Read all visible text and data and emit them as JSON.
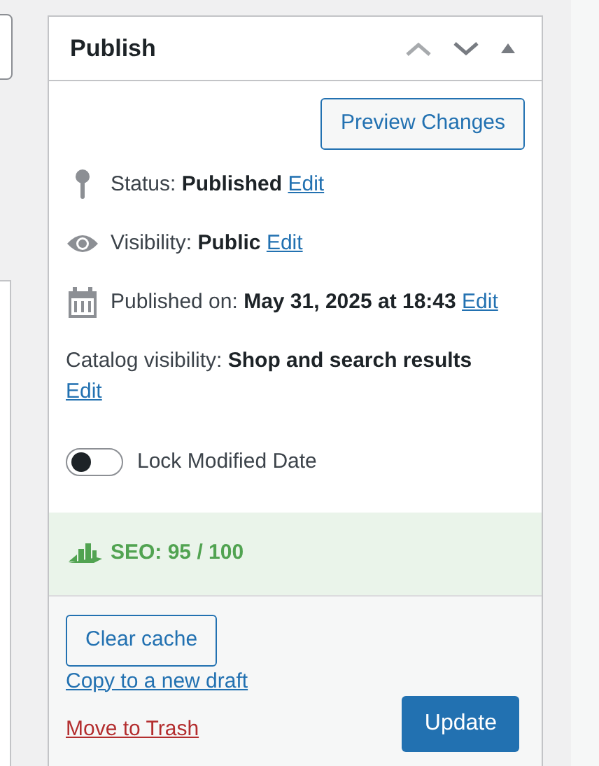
{
  "panel": {
    "title": "Publish",
    "expanded": true
  },
  "preview_button": "Preview Changes",
  "meta": [
    {
      "kind": "status",
      "label": "Status:",
      "value": "Published",
      "link": "Edit"
    },
    {
      "kind": "visibility",
      "label": "Visibility:",
      "value": "Public",
      "link": "Edit"
    },
    {
      "kind": "date",
      "label": "Published on:",
      "value": "May 31, 2025 at 18:43",
      "link": "Edit"
    },
    {
      "kind": "catalog",
      "label": "Catalog visibility:",
      "value": "Shop and search results",
      "link": "Edit"
    }
  ],
  "lock_modified": {
    "label": "Lock Modified Date",
    "on": false
  },
  "seo": {
    "text": "SEO: 95 / 100"
  },
  "actions": {
    "clear_cache": "Clear cache",
    "copy_link": "Copy to a new draft",
    "trash_link": "Move to Trash",
    "update_button": "Update"
  }
}
